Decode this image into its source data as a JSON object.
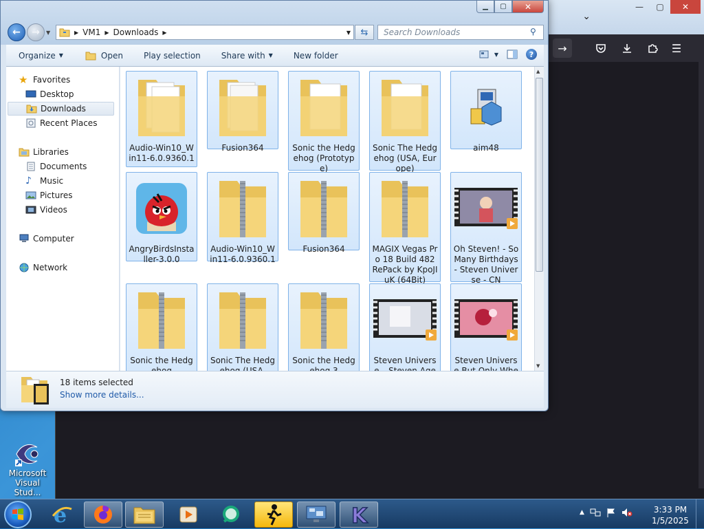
{
  "window": {
    "address": {
      "root": "VM1",
      "folder": "Downloads"
    },
    "search_placeholder": "Search Downloads",
    "toolbar": {
      "organize": "Organize",
      "open": "Open",
      "play_selection": "Play selection",
      "share_with": "Share with",
      "new_folder": "New folder"
    },
    "nav": {
      "favorites": "Favorites",
      "desktop": "Desktop",
      "downloads": "Downloads",
      "recent_places": "Recent Places",
      "libraries": "Libraries",
      "documents": "Documents",
      "music": "Music",
      "pictures": "Pictures",
      "videos": "Videos",
      "computer": "Computer",
      "network": "Network"
    },
    "items": [
      "Audio-Win10_Win11-6.0.9360.1",
      "Fusion364",
      "Sonic the Hedgehog (Prototype)",
      "Sonic The Hedgehog (USA, Europe)",
      "aim48",
      "AngryBirdsInstaller-3.0.0",
      "Audio-Win10_Win11-6.0.9360.1",
      "Fusion364",
      "MAGIX Vegas Pro 18 Build 482 RePack by KpoJIuK (64Bit)",
      "Oh Steven! - So Many Birthdays - Steven Universe - CN",
      "Sonic the Hedgehog",
      "Sonic The Hedgehog (USA,",
      "Sonic the Hedgehog 3",
      "Steven Universe _ Steven Ages And",
      "Steven Universe But Only When"
    ],
    "details": {
      "count": "18 items selected",
      "more": "Show more details..."
    }
  },
  "desktop_icon": "Microsoft Visual Stud...",
  "clock": {
    "time": "3:33 PM",
    "date": "1/5/2025"
  },
  "colors": {
    "folder": "#f2cf6a",
    "selection": "#d2e6fb",
    "accent": "#1d5eb5"
  }
}
